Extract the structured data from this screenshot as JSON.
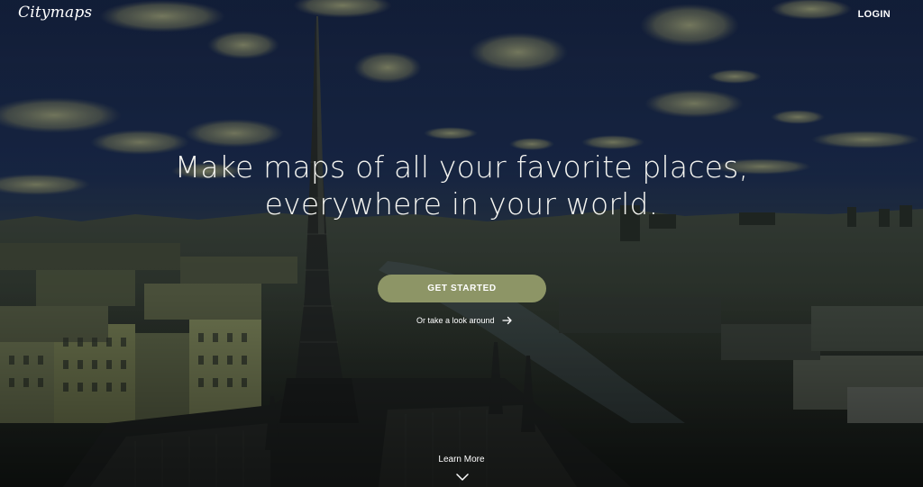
{
  "brand": {
    "logo_text": "Citymaps"
  },
  "nav": {
    "login_label": "LOGIN"
  },
  "hero": {
    "headline_line1": "Make maps of all your favorite places,",
    "headline_line2": "everywhere in your world.",
    "cta_label": "GET STARTED",
    "look_around_label": "Or take a look around",
    "learn_more_label": "Learn More"
  },
  "colors": {
    "cta_background": "#8d9566",
    "sky_top": "#1b2c4d",
    "overlay_tint": "#0a1220"
  },
  "icons": {
    "look_around": "arrow-right-icon",
    "learn_more": "chevron-down-icon"
  }
}
